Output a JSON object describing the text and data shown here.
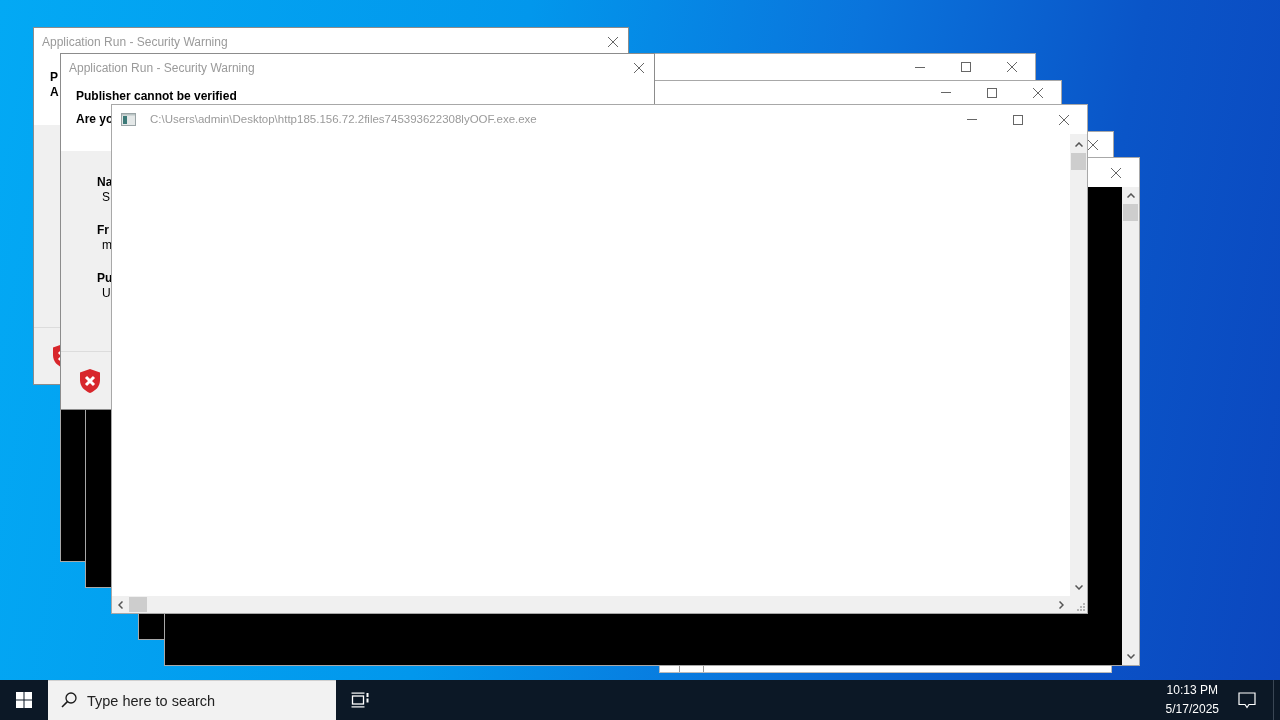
{
  "dialogs": [
    {
      "title": "Application Run - Security Warning",
      "header_lines": [
        "P",
        "A"
      ]
    },
    {
      "title": "Application Run - Security Warning",
      "header_lines": [
        "Publisher cannot be verified",
        "Are yo"
      ],
      "details": [
        {
          "label": "Na",
          "value": "S"
        },
        {
          "label": "Fr",
          "value": "m"
        },
        {
          "label": "Pu",
          "value": "U"
        }
      ]
    }
  ],
  "main_window": {
    "title": "C:\\Users\\admin\\Desktop\\http185.156.72.2files745393622308lyOOF.exe.exe"
  },
  "taskbar": {
    "search": {
      "placeholder": "Type here to search"
    },
    "clock": {
      "time": "10:13 PM",
      "date": "5/17/2025"
    }
  }
}
